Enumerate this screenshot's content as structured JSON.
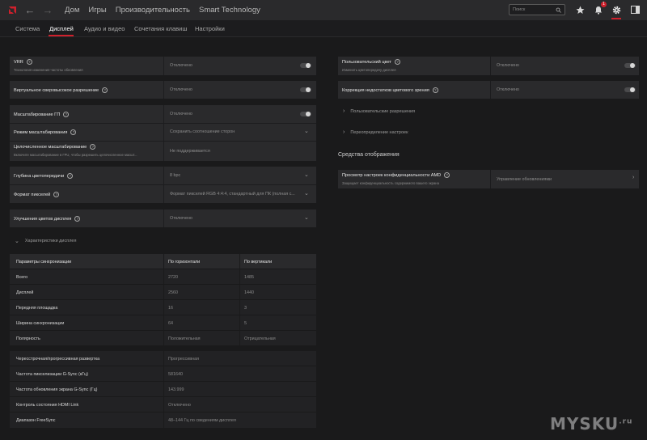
{
  "topbar": {
    "tabs": [
      "Дом",
      "Игры",
      "Производительность",
      "Smart Technology"
    ],
    "search_placeholder": "Поиск",
    "notification_count": "1"
  },
  "subtabs": [
    "Система",
    "Дисплей",
    "Аудио и видео",
    "Сочетания клавиш",
    "Настройки"
  ],
  "left": {
    "vrr": {
      "label": "VRR",
      "sub": "Технология изменения частоты обновления",
      "value": "Отключено"
    },
    "vsr": {
      "label": "Виртуальное сверхвысокое разрешение",
      "value": "Отключено"
    },
    "gpu_scaling": {
      "label": "Масштабирование ГП",
      "value": "Отключено"
    },
    "scaling_mode": {
      "label": "Режим масштабирования",
      "value": "Сохранить соотношение сторон"
    },
    "integer_scaling": {
      "label": "Целочисленное масштабирование",
      "sub": "Включите масштабирование в ГРU, чтобы разрешить целочисленное масшт...",
      "value": "Не поддерживается"
    },
    "color_depth": {
      "label": "Глубина цветопередачи",
      "value": "8 bpc"
    },
    "pixel_format": {
      "label": "Формат пикселей",
      "value": "Формат пикселей RGB 4:4:4, стандартный для ПК (полная с..."
    },
    "color_enh": {
      "label": "Улучшения цветов дисплея",
      "value": "Отключено"
    },
    "specs_toggle": "Характеристики дисплея",
    "table_header": [
      "Параметры синхронизации",
      "По горизонтали",
      "По вертикали"
    ],
    "table_rows": [
      [
        "Всего",
        "2720",
        "1485"
      ],
      [
        "Дисплей",
        "2560",
        "1440"
      ],
      [
        "Передняя площадка",
        "16",
        "3"
      ],
      [
        "Ширина синхронизации",
        "64",
        "5"
      ],
      [
        "Полярность",
        "Положительная",
        "Отрицательная"
      ]
    ],
    "info_rows": [
      [
        "Чересстрочная/прогрессивная развертка",
        "Прогрессивная"
      ],
      [
        "Частота пикселизации G-Sync (кГц)",
        "581640"
      ],
      [
        "Частота обновления экрана G-Sync (Гц)",
        "143.999"
      ],
      [
        "Контроль состояния HDMI Link",
        "Отключено"
      ],
      [
        "Диапазон FreeSync",
        "48–144 Гц по сведениям дисплея"
      ]
    ]
  },
  "right": {
    "custom_color": {
      "label": "Пользовательский цвет",
      "sub": "Изменить цветопередачу дисплея",
      "value": "Отключено"
    },
    "color_correction": {
      "label": "Коррекция недостатков цветового зрения",
      "value": "Отключено"
    },
    "custom_res": "Пользовательские разрешения",
    "override": "Переопределение настроек",
    "section": "Средства отображения",
    "privacy": {
      "label": "Просмотр настроек конфиденциальности AMD",
      "sub": "Защищает конфиденциальность содержимого вашего экрана",
      "value": "Управление обновлениями"
    }
  },
  "watermark": "MYSKU",
  "watermark_sup": ".ru"
}
